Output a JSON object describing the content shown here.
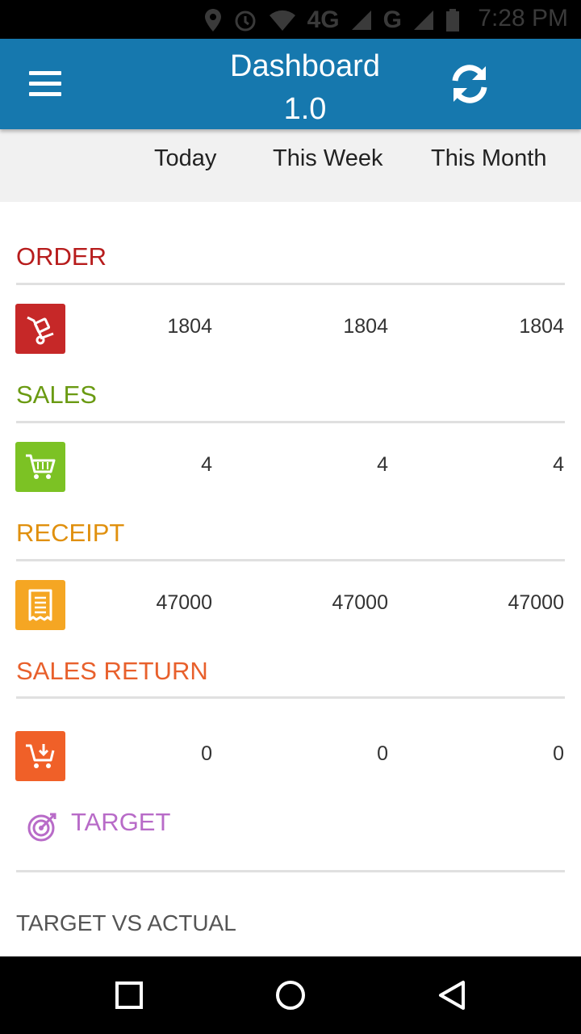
{
  "status_bar": {
    "network": "4G",
    "network2": "G",
    "time": "7:28 PM"
  },
  "app_bar": {
    "title_line1": "Dashboard",
    "title_line2": "1.0",
    "menu_icon": "hamburger-menu-icon",
    "refresh_icon": "refresh-icon",
    "color": "#1678ae"
  },
  "periods": [
    "Today",
    "This Week",
    "This Month"
  ],
  "sections": {
    "order": {
      "title": "ORDER",
      "color": "#b71c1c",
      "icon": "trolley-icon",
      "icon_bg": "#c62828",
      "values": [
        "1804",
        "1804",
        "1804"
      ]
    },
    "sales": {
      "title": "SALES",
      "color": "#6a9a12",
      "icon": "shopping-cart-icon",
      "icon_bg": "#7cc224",
      "values": [
        "4",
        "4",
        "4"
      ]
    },
    "receipt": {
      "title": "RECEIPT",
      "color": "#e0900e",
      "icon": "receipt-icon",
      "icon_bg": "#f5a623",
      "values": [
        "47000",
        "47000",
        "47000"
      ]
    },
    "sales_return": {
      "title": "SALES RETURN",
      "color": "#e8602c",
      "icon": "cart-return-icon",
      "icon_bg": "#f06028",
      "values": [
        "0",
        "0",
        "0"
      ]
    },
    "target": {
      "title": "TARGET",
      "color": "#b86bc8",
      "icon": "target-icon"
    },
    "target_vs_actual": {
      "title": "TARGET VS ACTUAL",
      "color": "#555555"
    }
  },
  "nav_bar": {
    "recents_icon": "recents-square-icon",
    "home_icon": "home-circle-icon",
    "back_icon": "back-triangle-icon"
  }
}
